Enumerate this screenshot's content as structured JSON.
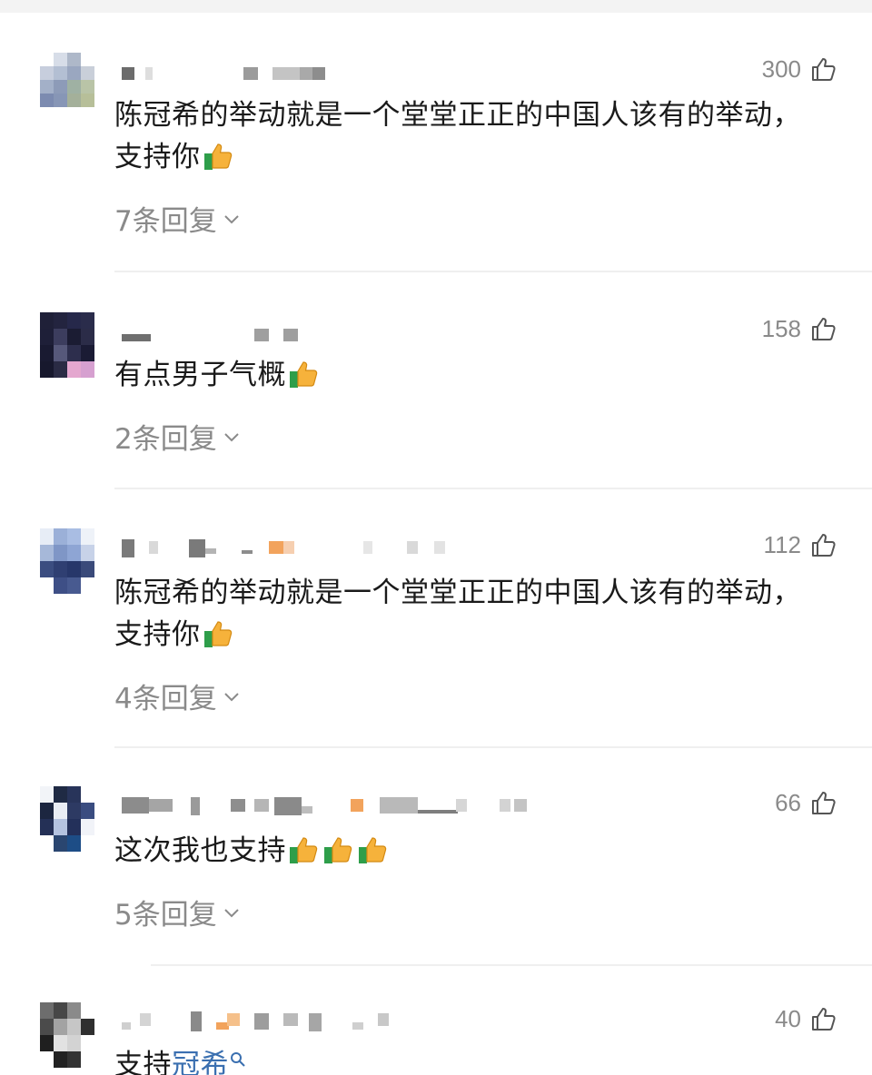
{
  "comments": [
    {
      "likes": "300",
      "text_line1": "陈冠希的举动就是一个堂堂正正的中国人该有的举动，",
      "text_line2": "支持你",
      "replies": "7条回复"
    },
    {
      "likes": "158",
      "text_line1": "有点男子气概",
      "text_line2": "",
      "replies": "2条回复"
    },
    {
      "likes": "112",
      "text_line1": "陈冠希的举动就是一个堂堂正正的中国人该有的举动，",
      "text_line2": "支持你",
      "replies": "4条回复"
    },
    {
      "likes": "66",
      "text_line1": "这次我也支持",
      "text_line2": "",
      "replies": "5条回复"
    },
    {
      "likes": "40",
      "text_prefix": "支持",
      "text_link": "冠希",
      "replies": ""
    }
  ],
  "icons": {
    "like": "thumbs-up-outline-icon",
    "emoji": "thumbs-up-emoji-icon",
    "expand": "chevron-down-icon",
    "search": "search-icon"
  },
  "colors": {
    "text": "#1a1a1a",
    "muted": "#8a8a8a",
    "link": "#3a6fb0",
    "divider": "#efefef"
  }
}
